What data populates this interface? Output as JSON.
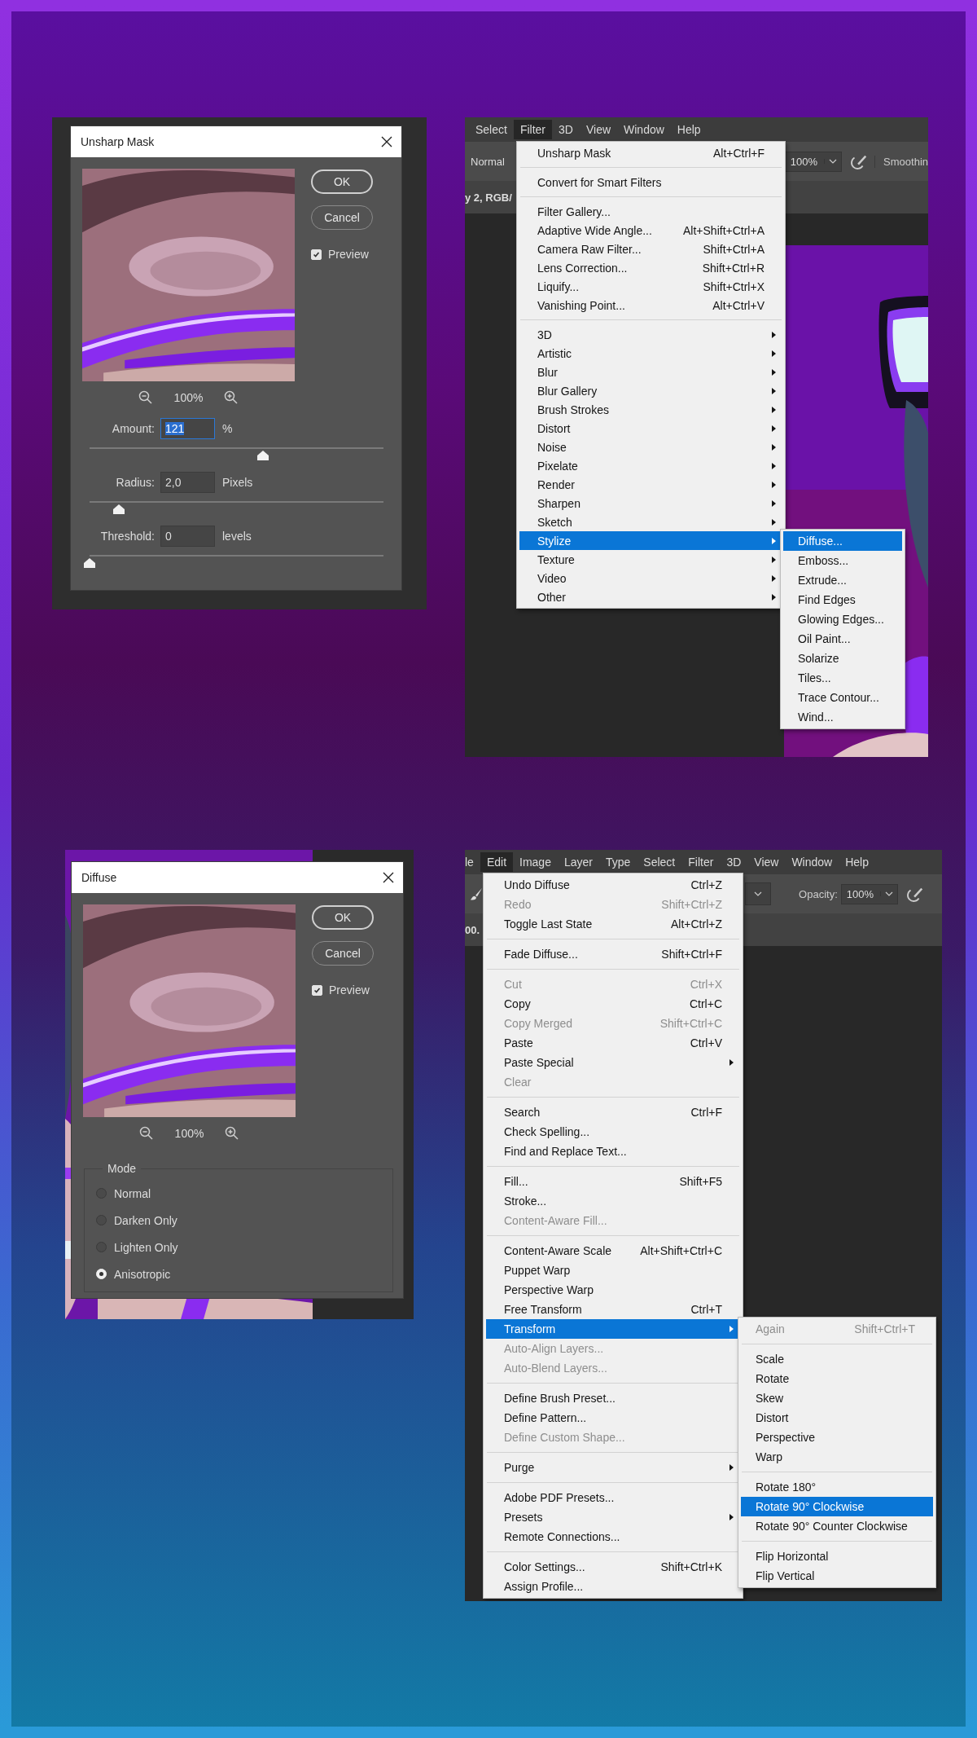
{
  "panels": [
    {
      "kind": "dialog",
      "title": "Unsharp Mask",
      "zoom": "100%",
      "buttons": [
        {
          "label": "OK",
          "default": true
        },
        {
          "label": "Cancel",
          "default": false
        }
      ],
      "preview": {
        "label": "Preview",
        "checked": true
      },
      "fields": [
        {
          "label": "Amount:",
          "value": "121",
          "unit": "%",
          "focused": true,
          "level": 0.59
        },
        {
          "label": "Radius:",
          "value": "2,0",
          "unit": "Pixels",
          "focused": false,
          "level": 0.1
        },
        {
          "label": "Threshold:",
          "value": "0",
          "unit": "levels",
          "focused": false,
          "level": 0
        }
      ]
    },
    {
      "kind": "screen",
      "menubar": [
        {
          "label": "Select",
          "selected": false
        },
        {
          "label": "Filter",
          "selected": true
        },
        {
          "label": "3D",
          "selected": false
        },
        {
          "label": "View",
          "selected": false
        },
        {
          "label": "Window",
          "selected": false
        },
        {
          "label": "Help",
          "selected": false
        }
      ],
      "toolbar": [
        {
          "kind": "field",
          "text": "Normal"
        },
        {
          "kind": "dropdown",
          "text": "100%"
        },
        {
          "kind": "airbrush"
        },
        {
          "kind": "label",
          "text": "Smoothin"
        }
      ],
      "document_tab": "y 2, RGB/",
      "canvas": {
        "kind": "picture"
      },
      "menu": {
        "groups": [
          [
            {
              "label": "Unsharp Mask",
              "shortcut": "Alt+Ctrl+F",
              "submenu": false,
              "disabled": false,
              "selected": false
            }
          ],
          [
            {
              "label": "Convert for Smart Filters",
              "submenu": false,
              "disabled": false,
              "selected": false
            }
          ],
          [
            {
              "label": "Filter Gallery...",
              "submenu": false,
              "disabled": false,
              "selected": false
            },
            {
              "label": "Adaptive Wide Angle...",
              "shortcut": "Alt+Shift+Ctrl+A",
              "submenu": false,
              "disabled": false,
              "selected": false
            },
            {
              "label": "Camera Raw Filter...",
              "shortcut": "Shift+Ctrl+A",
              "submenu": false,
              "disabled": false,
              "selected": false
            },
            {
              "label": "Lens Correction...",
              "shortcut": "Shift+Ctrl+R",
              "submenu": false,
              "disabled": false,
              "selected": false
            },
            {
              "label": "Liquify...",
              "shortcut": "Shift+Ctrl+X",
              "submenu": false,
              "disabled": false,
              "selected": false
            },
            {
              "label": "Vanishing Point...",
              "shortcut": "Alt+Ctrl+V",
              "submenu": false,
              "disabled": false,
              "selected": false
            }
          ],
          [
            {
              "label": "3D",
              "submenu": true,
              "disabled": false,
              "selected": false
            },
            {
              "label": "Artistic",
              "submenu": true,
              "disabled": false,
              "selected": false
            },
            {
              "label": "Blur",
              "submenu": true,
              "disabled": false,
              "selected": false
            },
            {
              "label": "Blur Gallery",
              "submenu": true,
              "disabled": false,
              "selected": false
            },
            {
              "label": "Brush Strokes",
              "submenu": true,
              "disabled": false,
              "selected": false
            },
            {
              "label": "Distort",
              "submenu": true,
              "disabled": false,
              "selected": false
            },
            {
              "label": "Noise",
              "submenu": true,
              "disabled": false,
              "selected": false
            },
            {
              "label": "Pixelate",
              "submenu": true,
              "disabled": false,
              "selected": false
            },
            {
              "label": "Render",
              "submenu": true,
              "disabled": false,
              "selected": false
            },
            {
              "label": "Sharpen",
              "submenu": true,
              "disabled": false,
              "selected": false
            },
            {
              "label": "Sketch",
              "submenu": true,
              "disabled": false,
              "selected": false
            },
            {
              "label": "Stylize",
              "submenu": true,
              "disabled": false,
              "selected": true
            },
            {
              "label": "Texture",
              "submenu": true,
              "disabled": false,
              "selected": false
            },
            {
              "label": "Video",
              "submenu": true,
              "disabled": false,
              "selected": false
            },
            {
              "label": "Other",
              "submenu": true,
              "disabled": false,
              "selected": false
            }
          ]
        ]
      },
      "submenu": {
        "groups": [
          [
            {
              "label": "Diffuse...",
              "submenu": false,
              "disabled": false,
              "selected": true
            },
            {
              "label": "Emboss...",
              "submenu": false,
              "disabled": false,
              "selected": false
            },
            {
              "label": "Extrude...",
              "submenu": false,
              "disabled": false,
              "selected": false
            },
            {
              "label": "Find Edges",
              "submenu": false,
              "disabled": false,
              "selected": false
            },
            {
              "label": "Glowing Edges...",
              "submenu": false,
              "disabled": false,
              "selected": false
            },
            {
              "label": "Oil Paint...",
              "submenu": false,
              "disabled": false,
              "selected": false
            },
            {
              "label": "Solarize",
              "submenu": false,
              "disabled": false,
              "selected": false
            },
            {
              "label": "Tiles...",
              "submenu": false,
              "disabled": false,
              "selected": false
            },
            {
              "label": "Trace Contour...",
              "submenu": false,
              "disabled": false,
              "selected": false
            },
            {
              "label": "Wind...",
              "submenu": false,
              "disabled": false,
              "selected": false
            }
          ]
        ]
      }
    },
    {
      "kind": "dialog",
      "title": "Diffuse",
      "zoom": "100%",
      "buttons": [
        {
          "label": "OK",
          "default": true
        },
        {
          "label": "Cancel",
          "default": false
        }
      ],
      "preview": {
        "label": "Preview",
        "checked": true
      },
      "mode": {
        "label": "Mode",
        "options": [
          {
            "label": "Normal",
            "selected": false
          },
          {
            "label": "Darken Only",
            "selected": false
          },
          {
            "label": "Lighten Only",
            "selected": false
          },
          {
            "label": "Anisotropic",
            "selected": true
          }
        ]
      }
    },
    {
      "kind": "screen",
      "menubar": [
        {
          "label": "le",
          "selected": false
        },
        {
          "label": "Edit",
          "selected": true
        },
        {
          "label": "Image",
          "selected": false
        },
        {
          "label": "Layer",
          "selected": false
        },
        {
          "label": "Type",
          "selected": false
        },
        {
          "label": "Select",
          "selected": false
        },
        {
          "label": "Filter",
          "selected": false
        },
        {
          "label": "3D",
          "selected": false
        },
        {
          "label": "View",
          "selected": false
        },
        {
          "label": "Window",
          "selected": false
        },
        {
          "label": "Help",
          "selected": false
        }
      ],
      "toolbar": [
        {
          "kind": "brush"
        },
        {
          "kind": "caret"
        },
        {
          "kind": "label",
          "text": "Opacity:"
        },
        {
          "kind": "dropdown",
          "text": "100%"
        },
        {
          "kind": "airbrush"
        }
      ],
      "document_tab": "00.",
      "menu": {
        "groups": [
          [
            {
              "label": "Undo Diffuse",
              "shortcut": "Ctrl+Z",
              "submenu": false,
              "disabled": false,
              "selected": false
            },
            {
              "label": "Redo",
              "shortcut": "Shift+Ctrl+Z",
              "submenu": false,
              "disabled": true,
              "selected": false
            },
            {
              "label": "Toggle Last State",
              "shortcut": "Alt+Ctrl+Z",
              "submenu": false,
              "disabled": false,
              "selected": false
            }
          ],
          [
            {
              "label": "Fade Diffuse...",
              "shortcut": "Shift+Ctrl+F",
              "submenu": false,
              "disabled": false,
              "selected": false
            }
          ],
          [
            {
              "label": "Cut",
              "shortcut": "Ctrl+X",
              "submenu": false,
              "disabled": true,
              "selected": false
            },
            {
              "label": "Copy",
              "shortcut": "Ctrl+C",
              "submenu": false,
              "disabled": false,
              "selected": false
            },
            {
              "label": "Copy Merged",
              "shortcut": "Shift+Ctrl+C",
              "submenu": false,
              "disabled": true,
              "selected": false
            },
            {
              "label": "Paste",
              "shortcut": "Ctrl+V",
              "submenu": false,
              "disabled": false,
              "selected": false
            },
            {
              "label": "Paste Special",
              "submenu": true,
              "disabled": false,
              "selected": false
            },
            {
              "label": "Clear",
              "submenu": false,
              "disabled": true,
              "selected": false
            }
          ],
          [
            {
              "label": "Search",
              "shortcut": "Ctrl+F",
              "submenu": false,
              "disabled": false,
              "selected": false
            },
            {
              "label": "Check Spelling...",
              "submenu": false,
              "disabled": false,
              "selected": false
            },
            {
              "label": "Find and Replace Text...",
              "submenu": false,
              "disabled": false,
              "selected": false
            }
          ],
          [
            {
              "label": "Fill...",
              "shortcut": "Shift+F5",
              "submenu": false,
              "disabled": false,
              "selected": false
            },
            {
              "label": "Stroke...",
              "submenu": false,
              "disabled": false,
              "selected": false
            },
            {
              "label": "Content-Aware Fill...",
              "submenu": false,
              "disabled": true,
              "selected": false
            }
          ],
          [
            {
              "label": "Content-Aware Scale",
              "shortcut": "Alt+Shift+Ctrl+C",
              "submenu": false,
              "disabled": false,
              "selected": false
            },
            {
              "label": "Puppet Warp",
              "submenu": false,
              "disabled": false,
              "selected": false
            },
            {
              "label": "Perspective Warp",
              "submenu": false,
              "disabled": false,
              "selected": false
            },
            {
              "label": "Free Transform",
              "shortcut": "Ctrl+T",
              "submenu": false,
              "disabled": false,
              "selected": false
            },
            {
              "label": "Transform",
              "submenu": true,
              "disabled": false,
              "selected": true
            },
            {
              "label": "Auto-Align Layers...",
              "submenu": false,
              "disabled": true,
              "selected": false
            },
            {
              "label": "Auto-Blend Layers...",
              "submenu": false,
              "disabled": true,
              "selected": false
            }
          ],
          [
            {
              "label": "Define Brush Preset...",
              "submenu": false,
              "disabled": false,
              "selected": false
            },
            {
              "label": "Define Pattern...",
              "submenu": false,
              "disabled": false,
              "selected": false
            },
            {
              "label": "Define Custom Shape...",
              "submenu": false,
              "disabled": true,
              "selected": false
            }
          ],
          [
            {
              "label": "Purge",
              "submenu": true,
              "disabled": false,
              "selected": false
            }
          ],
          [
            {
              "label": "Adobe PDF Presets...",
              "submenu": false,
              "disabled": false,
              "selected": false
            },
            {
              "label": "Presets",
              "submenu": true,
              "disabled": false,
              "selected": false
            },
            {
              "label": "Remote Connections...",
              "submenu": false,
              "disabled": false,
              "selected": false
            }
          ],
          [
            {
              "label": "Color Settings...",
              "shortcut": "Shift+Ctrl+K",
              "submenu": false,
              "disabled": false,
              "selected": false
            },
            {
              "label": "Assign Profile...",
              "submenu": false,
              "disabled": false,
              "selected": false
            }
          ]
        ]
      },
      "submenu": {
        "groups": [
          [
            {
              "label": "Again",
              "shortcut": "Shift+Ctrl+T",
              "submenu": false,
              "disabled": true,
              "selected": false
            }
          ],
          [
            {
              "label": "Scale",
              "submenu": false,
              "disabled": false,
              "selected": false
            },
            {
              "label": "Rotate",
              "submenu": false,
              "disabled": false,
              "selected": false
            },
            {
              "label": "Skew",
              "submenu": false,
              "disabled": false,
              "selected": false
            },
            {
              "label": "Distort",
              "submenu": false,
              "disabled": false,
              "selected": false
            },
            {
              "label": "Perspective",
              "submenu": false,
              "disabled": false,
              "selected": false
            },
            {
              "label": "Warp",
              "submenu": false,
              "disabled": false,
              "selected": false
            }
          ],
          [
            {
              "label": "Rotate 180°",
              "submenu": false,
              "disabled": false,
              "selected": false
            },
            {
              "label": "Rotate 90° Clockwise",
              "submenu": false,
              "disabled": false,
              "selected": true
            },
            {
              "label": "Rotate 90° Counter Clockwise",
              "submenu": false,
              "disabled": false,
              "selected": false
            }
          ],
          [
            {
              "label": "Flip Horizontal",
              "submenu": false,
              "disabled": false,
              "selected": false
            },
            {
              "label": "Flip Vertical",
              "submenu": false,
              "disabled": false,
              "selected": false
            }
          ]
        ]
      }
    }
  ]
}
